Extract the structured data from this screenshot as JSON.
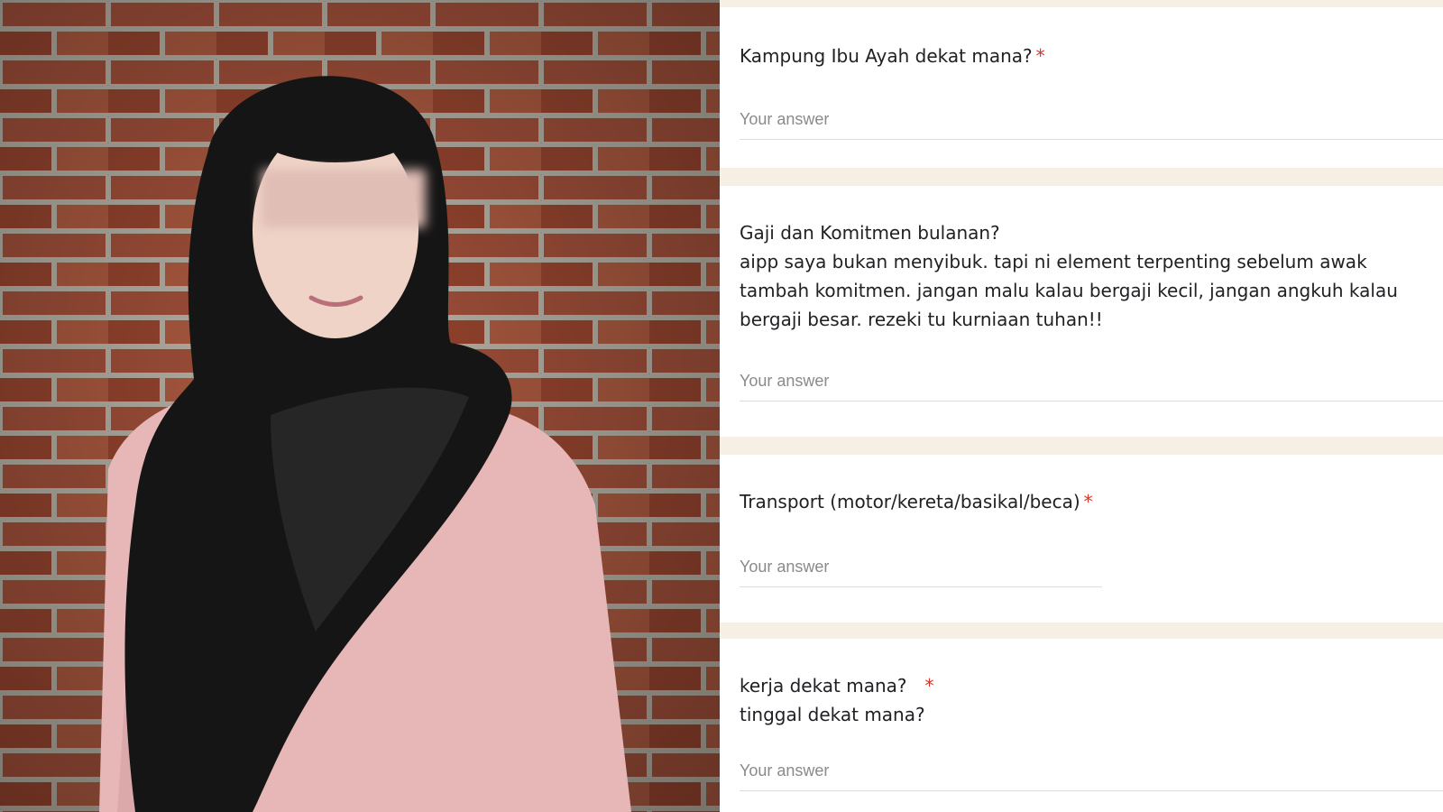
{
  "photo": {
    "description_icon": "person-photo"
  },
  "form": {
    "required_mark": "*",
    "questions": [
      {
        "title": "Kampung Ibu Ayah dekat mana?",
        "required": true,
        "placeholder": "Your answer"
      },
      {
        "title": "Gaji dan Komitmen bulanan?\naipp saya bukan menyibuk. tapi ni element terpenting sebelum awak tambah komitmen. jangan malu kalau bergaji kecil, jangan angkuh kalau bergaji besar. rezeki tu kurniaan tuhan!!",
        "required": false,
        "placeholder": "Your answer"
      },
      {
        "title": "Transport (motor/kereta/basikal/beca)",
        "required": true,
        "placeholder": "Your answer"
      },
      {
        "title": "kerja dekat mana?",
        "title_line2": "tinggal dekat mana?",
        "required": true,
        "placeholder": "Your answer"
      }
    ]
  },
  "colors": {
    "form_background": "#f6efe3",
    "card": "#ffffff",
    "required": "#d93025",
    "placeholder": "#8a8a8a"
  }
}
